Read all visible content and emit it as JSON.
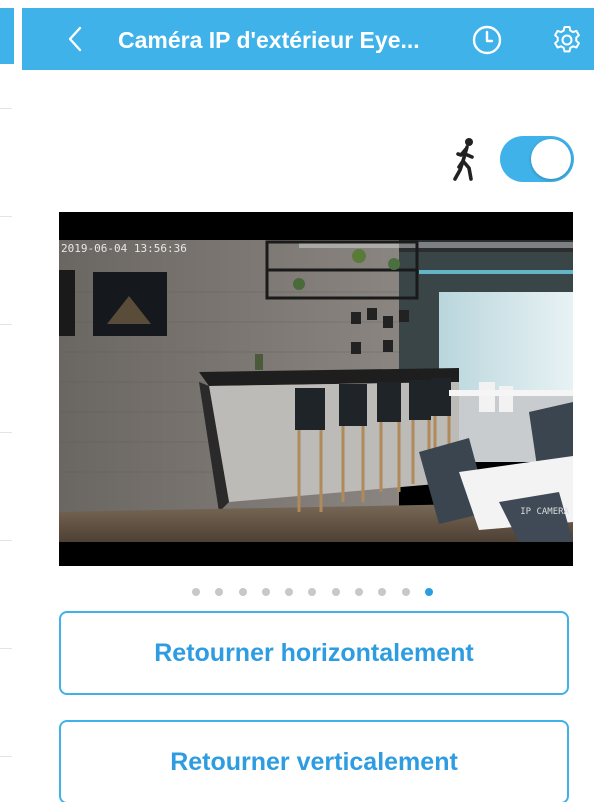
{
  "header": {
    "title": "Caméra IP d'extérieur Eye...",
    "back_icon": "chevron-left-icon",
    "history_icon": "clock-icon",
    "settings_icon": "gear-icon"
  },
  "motion_detection": {
    "icon": "walking-person-icon",
    "enabled": true
  },
  "camera_feed": {
    "timestamp": "2019-06-04 13:56:36",
    "label": "IP CAMERA"
  },
  "pager": {
    "total": 11,
    "active_index": 10
  },
  "actions": {
    "flip_horizontal_label": "Retourner horizontalement",
    "flip_vertical_label": "Retourner verticalement"
  },
  "colors": {
    "accent": "#3fb2ea",
    "button_text": "#2d9ce0",
    "dot_inactive": "#c8c8c8"
  }
}
